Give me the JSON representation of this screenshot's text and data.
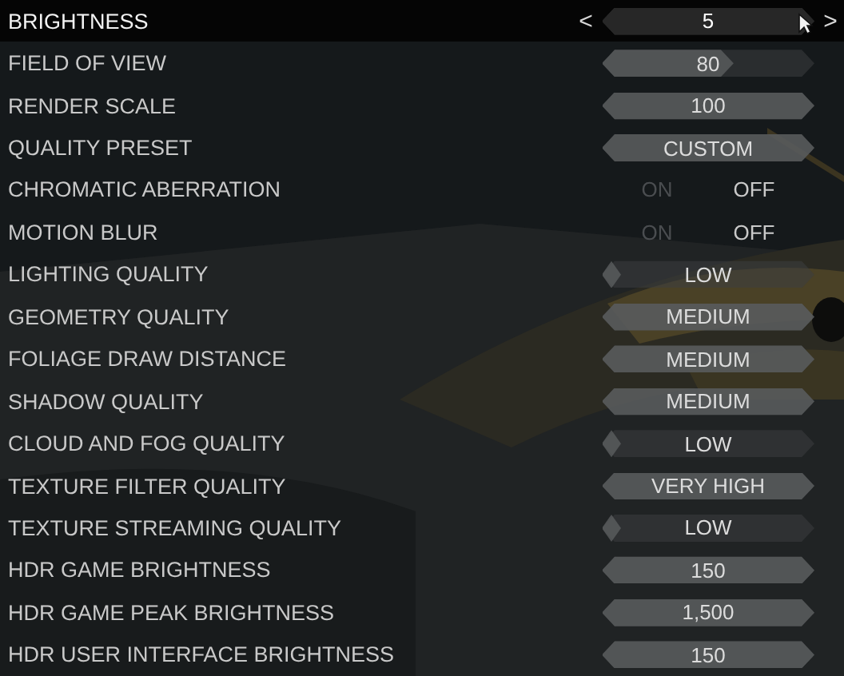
{
  "rows": [
    {
      "label": "BRIGHTNESS",
      "kind": "slider",
      "value": "5",
      "level": 1,
      "selected": true,
      "prev": "<",
      "next": ">"
    },
    {
      "label": "FIELD OF VIEW",
      "kind": "slider",
      "value": "80",
      "level": 0.62,
      "selected": false
    },
    {
      "label": "RENDER SCALE",
      "kind": "slider",
      "value": "100",
      "level": 1,
      "selected": false
    },
    {
      "label": "QUALITY PRESET",
      "kind": "slider",
      "value": "CUSTOM",
      "level": 1,
      "selected": false
    },
    {
      "label": "CHROMATIC ABERRATION",
      "kind": "toggle",
      "selected": false,
      "options": [
        {
          "label": "ON",
          "selected": false
        },
        {
          "label": "OFF",
          "selected": true
        }
      ]
    },
    {
      "label": "MOTION BLUR",
      "kind": "toggle",
      "selected": false,
      "options": [
        {
          "label": "ON",
          "selected": false
        },
        {
          "label": "OFF",
          "selected": true
        }
      ]
    },
    {
      "label": "LIGHTING QUALITY",
      "kind": "slider",
      "value": "LOW",
      "level": 0.08,
      "selected": false
    },
    {
      "label": "GEOMETRY QUALITY",
      "kind": "slider",
      "value": "MEDIUM",
      "level": 1,
      "selected": false
    },
    {
      "label": "FOLIAGE DRAW DISTANCE",
      "kind": "slider",
      "value": "MEDIUM",
      "level": 1,
      "selected": false
    },
    {
      "label": "SHADOW QUALITY",
      "kind": "slider",
      "value": "MEDIUM",
      "level": 1,
      "selected": false
    },
    {
      "label": "CLOUD AND FOG QUALITY",
      "kind": "slider",
      "value": "LOW",
      "level": 0.08,
      "selected": false
    },
    {
      "label": "TEXTURE FILTER QUALITY",
      "kind": "slider",
      "value": "VERY HIGH",
      "level": 1,
      "selected": false
    },
    {
      "label": "TEXTURE STREAMING QUALITY",
      "kind": "slider",
      "value": "LOW",
      "level": 0.08,
      "selected": false
    },
    {
      "label": "HDR GAME BRIGHTNESS",
      "kind": "slider",
      "value": "150",
      "level": 1,
      "selected": false
    },
    {
      "label": "HDR GAME PEAK BRIGHTNESS",
      "kind": "slider",
      "value": "1,500",
      "level": 1,
      "selected": false
    },
    {
      "label": "HDR USER INTERFACE BRIGHTNESS",
      "kind": "slider",
      "value": "150",
      "level": 1,
      "selected": false
    }
  ]
}
